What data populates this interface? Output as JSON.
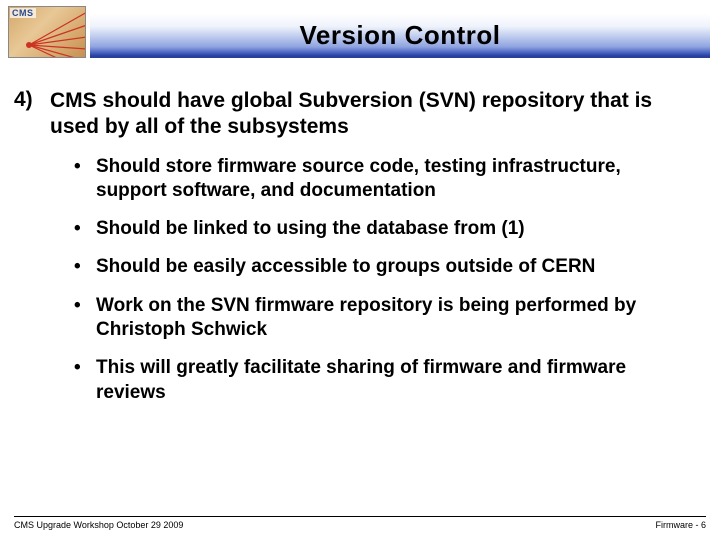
{
  "header": {
    "logo_label": "CMS",
    "title": "Version Control"
  },
  "main": {
    "number": "4)",
    "text": "CMS should have global Subversion (SVN) repository that is used by all of the subsystems",
    "bullets": [
      "Should store firmware source code, testing infrastructure, support software, and documentation",
      "Should be linked to using the database from (1)",
      "Should be easily accessible to groups outside of CERN",
      "Work on the SVN firmware repository is being performed by Christoph Schwick",
      "This will greatly facilitate sharing of firmware and firmware reviews"
    ]
  },
  "footer": {
    "left": "CMS Upgrade Workshop October 29 2009",
    "right": "Firmware -  6"
  }
}
